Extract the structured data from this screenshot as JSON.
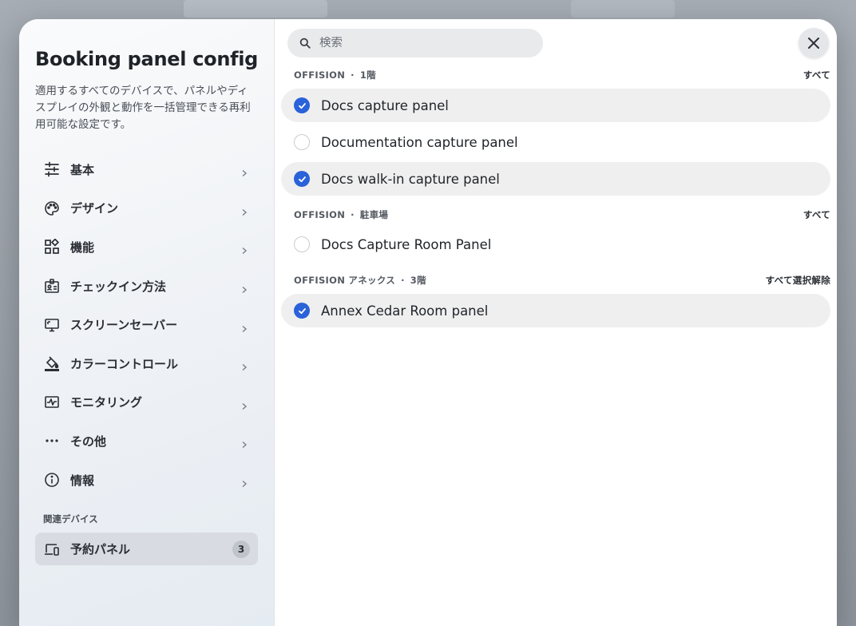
{
  "dialog": {
    "title": "Booking panel config",
    "description": "適用するすべてのデバイスで、パネルやディスプレイの外観と動作を一括管理できる再利用可能な設定です。"
  },
  "nav": {
    "items": [
      {
        "label": "基本",
        "icon": "sliders-icon"
      },
      {
        "label": "デザイン",
        "icon": "palette-icon"
      },
      {
        "label": "機能",
        "icon": "widgets-icon"
      },
      {
        "label": "チェックイン方法",
        "icon": "badge-icon"
      },
      {
        "label": "スクリーンセーバー",
        "icon": "monitor-icon"
      },
      {
        "label": "カラーコントロール",
        "icon": "paint-bucket-icon"
      },
      {
        "label": "モニタリング",
        "icon": "monitoring-icon"
      },
      {
        "label": "その他",
        "icon": "more-horizontal-icon"
      },
      {
        "label": "情報",
        "icon": "info-icon"
      }
    ]
  },
  "related": {
    "section_label": "関連デバイス",
    "device_label": "予約パネル",
    "device_count": "3"
  },
  "search": {
    "placeholder": "検索",
    "value": ""
  },
  "groups": [
    {
      "building": "OFFISION",
      "separator": "·",
      "floor": "1階",
      "action": "すべて",
      "panels": [
        {
          "name": "Docs capture panel",
          "selected": true
        },
        {
          "name": "Documentation capture panel",
          "selected": false
        },
        {
          "name": "Docs walk-in capture panel",
          "selected": true
        }
      ]
    },
    {
      "building": "OFFISION",
      "separator": "·",
      "floor": "駐車場",
      "action": "すべて",
      "panels": [
        {
          "name": "Docs Capture Room Panel",
          "selected": false
        }
      ]
    },
    {
      "building": "OFFISION アネックス",
      "separator": "·",
      "floor": "3階",
      "action": "すべて選択解除",
      "panels": [
        {
          "name": "Annex Cedar Room panel",
          "selected": true
        }
      ]
    }
  ],
  "colors": {
    "accent": "#2a62d9",
    "selected_row": "#efefef",
    "related_active": "#d8dce2"
  }
}
